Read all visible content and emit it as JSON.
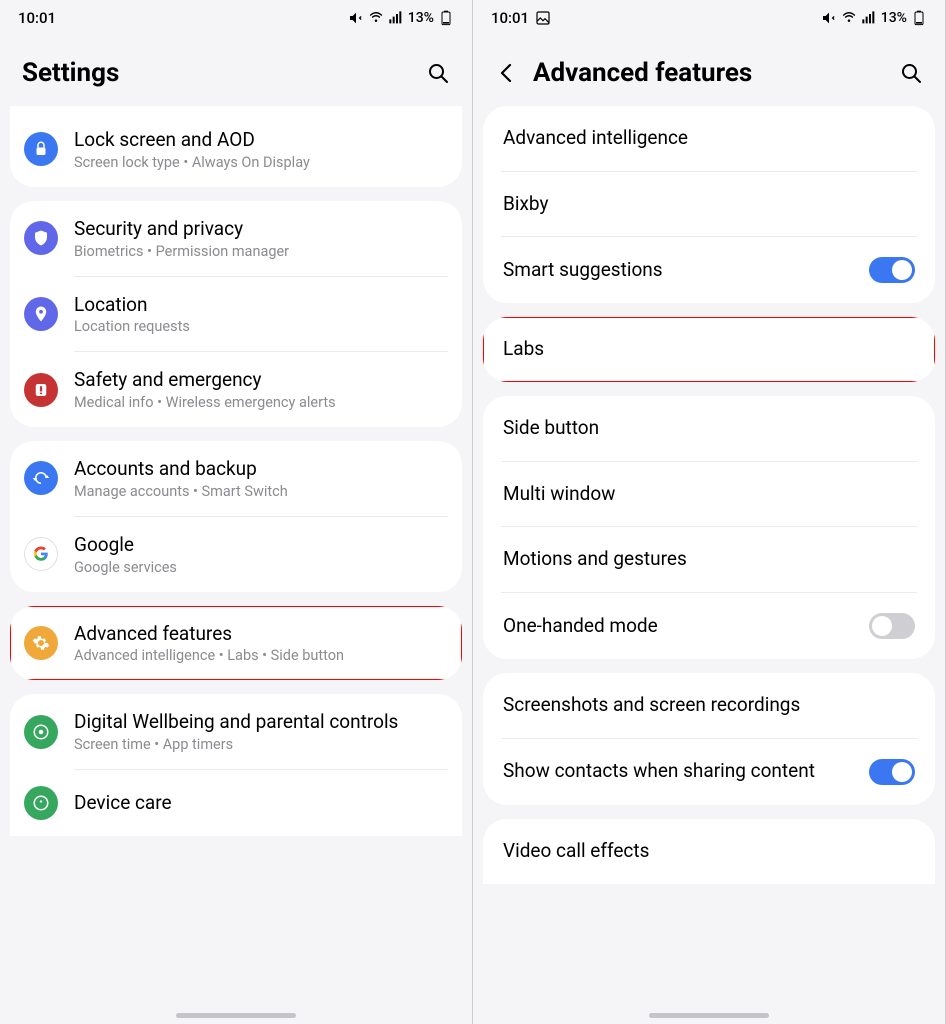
{
  "status": {
    "time": "10:01",
    "battery": "13%"
  },
  "left": {
    "title": "Settings",
    "groups": [
      [
        {
          "icon": "lock",
          "bg": "#3a77f1",
          "title": "Lock screen and AOD",
          "sub": "Screen lock type  •  Always On Display"
        }
      ],
      [
        {
          "icon": "shield",
          "bg": "#6067e8",
          "title": "Security and privacy",
          "sub": "Biometrics  •  Permission manager"
        },
        {
          "icon": "pin",
          "bg": "#6067e8",
          "title": "Location",
          "sub": "Location requests"
        },
        {
          "icon": "alert",
          "bg": "#c53433",
          "title": "Safety and emergency",
          "sub": "Medical info  •  Wireless emergency alerts"
        }
      ],
      [
        {
          "icon": "sync",
          "bg": "#3a77f1",
          "title": "Accounts and backup",
          "sub": "Manage accounts  •  Smart Switch"
        },
        {
          "icon": "g",
          "bg": "#ffffff",
          "title": "Google",
          "sub": "Google services"
        }
      ],
      [
        {
          "icon": "gear",
          "bg": "#f0a83a",
          "title": "Advanced features",
          "sub": "Advanced intelligence  •  Labs  •  Side button",
          "highlight": true
        }
      ],
      [
        {
          "icon": "wellbeing",
          "bg": "#36a75e",
          "title": "Digital Wellbeing and parental controls",
          "sub": "Screen time  •  App timers"
        },
        {
          "icon": "care",
          "bg": "#36a75e",
          "title": "Device care",
          "sub": ""
        }
      ]
    ]
  },
  "right": {
    "title": "Advanced features",
    "groups": [
      [
        {
          "title": "Advanced intelligence"
        },
        {
          "title": "Bixby"
        },
        {
          "title": "Smart suggestions",
          "toggle": "on"
        }
      ],
      [
        {
          "title": "Labs",
          "highlight": true
        }
      ],
      [
        {
          "title": "Side button"
        },
        {
          "title": "Multi window"
        },
        {
          "title": "Motions and gestures"
        },
        {
          "title": "One-handed mode",
          "toggle": "off"
        }
      ],
      [
        {
          "title": "Screenshots and screen recordings"
        },
        {
          "title": "Show contacts when sharing content",
          "toggle": "on"
        }
      ],
      [
        {
          "title": "Video call effects"
        }
      ]
    ]
  }
}
